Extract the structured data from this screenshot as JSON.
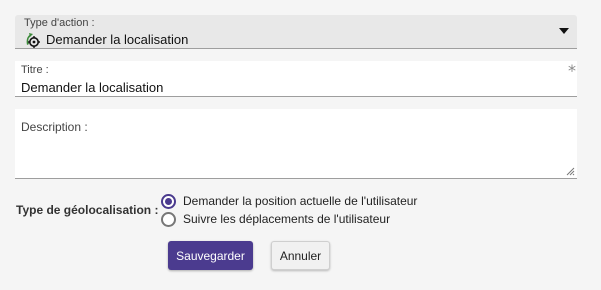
{
  "form": {
    "action_type": {
      "label": "Type d'action :",
      "value": "Demander la localisation",
      "icon": "geolocation-icon"
    },
    "title": {
      "label": "Titre :",
      "value": "Demander la localisation",
      "required_mark": "*"
    },
    "description": {
      "label": "Description :",
      "value": ""
    },
    "geolocation_type": {
      "label": "Type de géolocalisation :",
      "options": [
        {
          "label": "Demander la position actuelle de l'utilisateur",
          "checked": true
        },
        {
          "label": "Suivre les déplacements de l'utilisateur",
          "checked": false
        }
      ]
    },
    "buttons": {
      "save": "Sauvegarder",
      "cancel": "Annuler"
    }
  },
  "colors": {
    "accent": "#4b3b8f",
    "background": "#f5f5f5",
    "select_background": "#e8e8e8",
    "icon_green": "#3c8a3a"
  }
}
